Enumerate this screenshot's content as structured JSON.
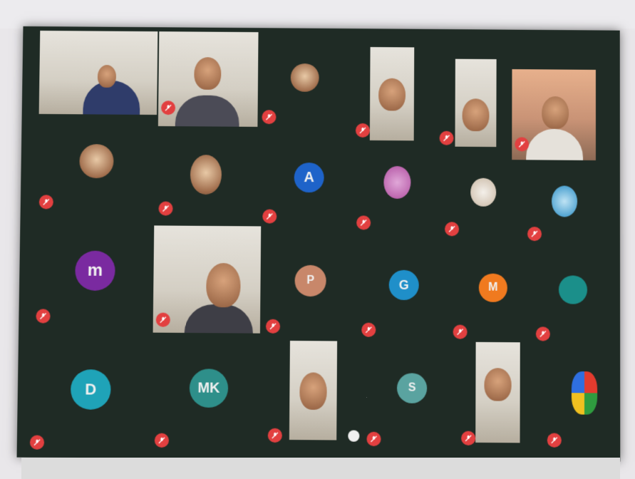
{
  "meeting": {
    "participants": [
      {
        "id": "p1",
        "name": "",
        "kind": "video",
        "tone": "light"
      },
      {
        "id": "p2",
        "name": "",
        "kind": "video",
        "tone": "light"
      },
      {
        "id": "p3",
        "name": "",
        "kind": "photo-avatar"
      },
      {
        "id": "p4",
        "name": "",
        "kind": "video",
        "tone": "light"
      },
      {
        "id": "p5",
        "name": "",
        "kind": "video",
        "tone": "light"
      },
      {
        "id": "p6",
        "name": "",
        "kind": "video",
        "tone": "warm"
      },
      {
        "id": "p7",
        "name": "",
        "kind": "photo-avatar"
      },
      {
        "id": "p8",
        "name": "",
        "kind": "photo-avatar"
      },
      {
        "id": "p9",
        "name": "",
        "kind": "letter",
        "letter": "A",
        "color": "#1e63c9"
      },
      {
        "id": "p10",
        "name": "",
        "kind": "photo-avatar"
      },
      {
        "id": "p11",
        "name": "",
        "kind": "photo-avatar"
      },
      {
        "id": "p12",
        "name": "",
        "kind": "photo-avatar"
      },
      {
        "id": "p13",
        "name": "",
        "kind": "letter",
        "letter": "m",
        "color": "#7a2aa0"
      },
      {
        "id": "p14",
        "name": "",
        "kind": "video",
        "tone": "light"
      },
      {
        "id": "p15",
        "name": "",
        "kind": "letter",
        "letter": "P",
        "color": "#c8876a"
      },
      {
        "id": "p16",
        "name": "",
        "kind": "letter",
        "letter": "G",
        "color": "#1f8fc9"
      },
      {
        "id": "p17",
        "name": "",
        "kind": "letter",
        "letter": "M",
        "color": "#f07a1f"
      },
      {
        "id": "p18",
        "name": "",
        "kind": "letter",
        "letter": "",
        "color": "#1b8f8a"
      },
      {
        "id": "p19",
        "name": "",
        "kind": "letter",
        "letter": "D",
        "color": "#1fa3b8"
      },
      {
        "id": "p20",
        "name": "",
        "kind": "letter",
        "letter": "MK",
        "color": "#2e8f8a"
      },
      {
        "id": "p21",
        "name": "",
        "kind": "video",
        "tone": "light"
      },
      {
        "id": "p22",
        "name": "",
        "kind": "letter",
        "letter": "S",
        "color": "#5aa3a0"
      },
      {
        "id": "p23",
        "name": "",
        "kind": "video",
        "tone": "light"
      },
      {
        "id": "p24",
        "name": "",
        "kind": "photo-avatar"
      }
    ]
  },
  "icons": {
    "muted": "mic-off-icon"
  },
  "colors": {
    "tile_bg": "#1f2b25",
    "mic_red": "#e24040"
  }
}
